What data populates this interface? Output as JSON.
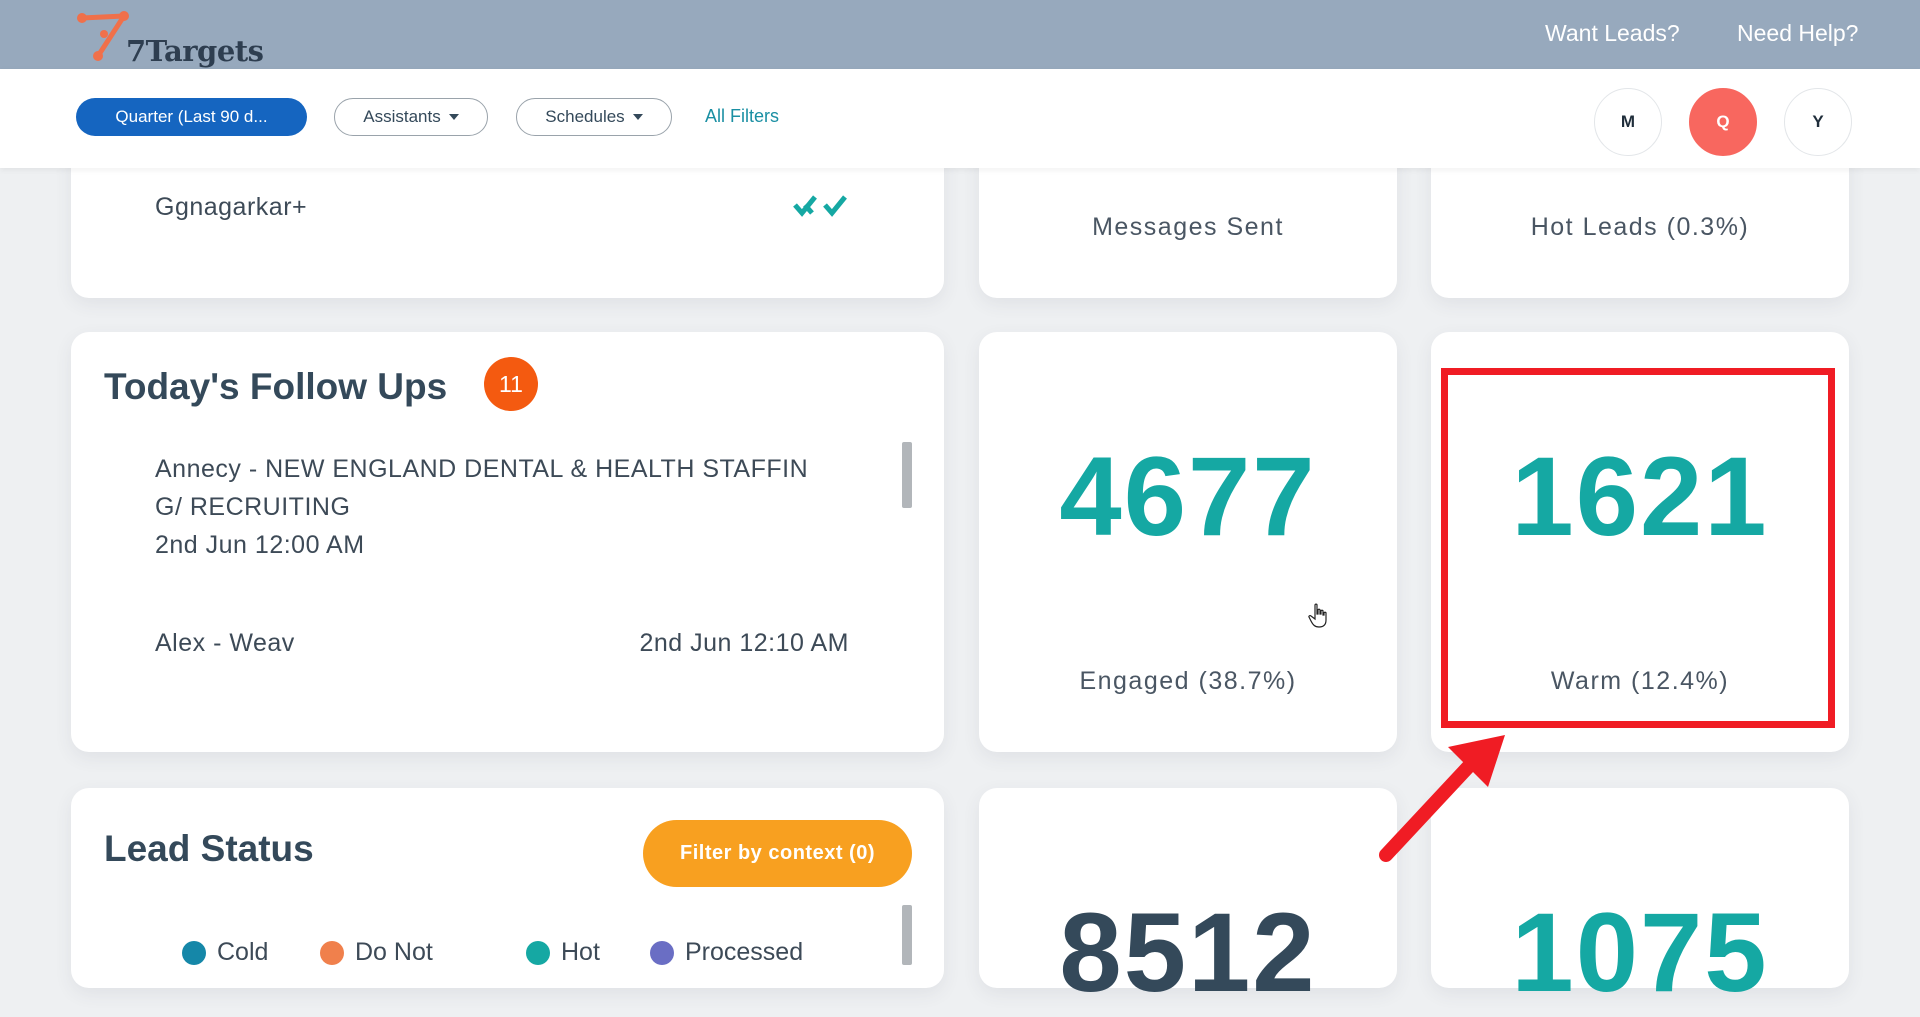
{
  "header": {
    "brand": "7Targets",
    "links": [
      "Want Leads?",
      "Need Help?"
    ]
  },
  "filters": {
    "period": "Quarter (Last 90 d...",
    "assistants": "Assistants",
    "schedules": "Schedules",
    "all_filters": "All Filters",
    "period_buttons": [
      "M",
      "Q",
      "Y"
    ],
    "active_period": "Q"
  },
  "top_row": {
    "contact_name": "Ggnagarkar+",
    "messages_label": "Messages Sent",
    "hot_leads_label": "Hot Leads (0.3%)"
  },
  "follow_ups": {
    "title": "Today's Follow Ups",
    "count": "11",
    "items": [
      {
        "line1": "Annecy - NEW ENGLAND DENTAL & HEALTH STAFFIN",
        "line2": "G/ RECRUITING",
        "time": "2nd Jun 12:00 AM"
      },
      {
        "name": "Alex - Weav",
        "time": "2nd Jun 12:10 AM"
      }
    ]
  },
  "stats": {
    "engaged": {
      "value": "4677",
      "label": "Engaged (38.7%)"
    },
    "warm": {
      "value": "1621",
      "label": "Warm (12.4%)"
    },
    "bottom_left": {
      "value": "8512"
    },
    "bottom_right": {
      "value": "1075"
    }
  },
  "lead_status": {
    "title": "Lead Status",
    "filter_button": "Filter by context (0)",
    "legend": [
      "Cold",
      "Do Not",
      "Hot",
      "Processed"
    ]
  },
  "colors": {
    "accent_teal": "#15a8a3",
    "primary_blue": "#1565c0",
    "active_period": "#f8675f",
    "badge_orange": "#f45a10",
    "filter_orange": "#f8a020",
    "highlight_red": "#f01c24"
  }
}
